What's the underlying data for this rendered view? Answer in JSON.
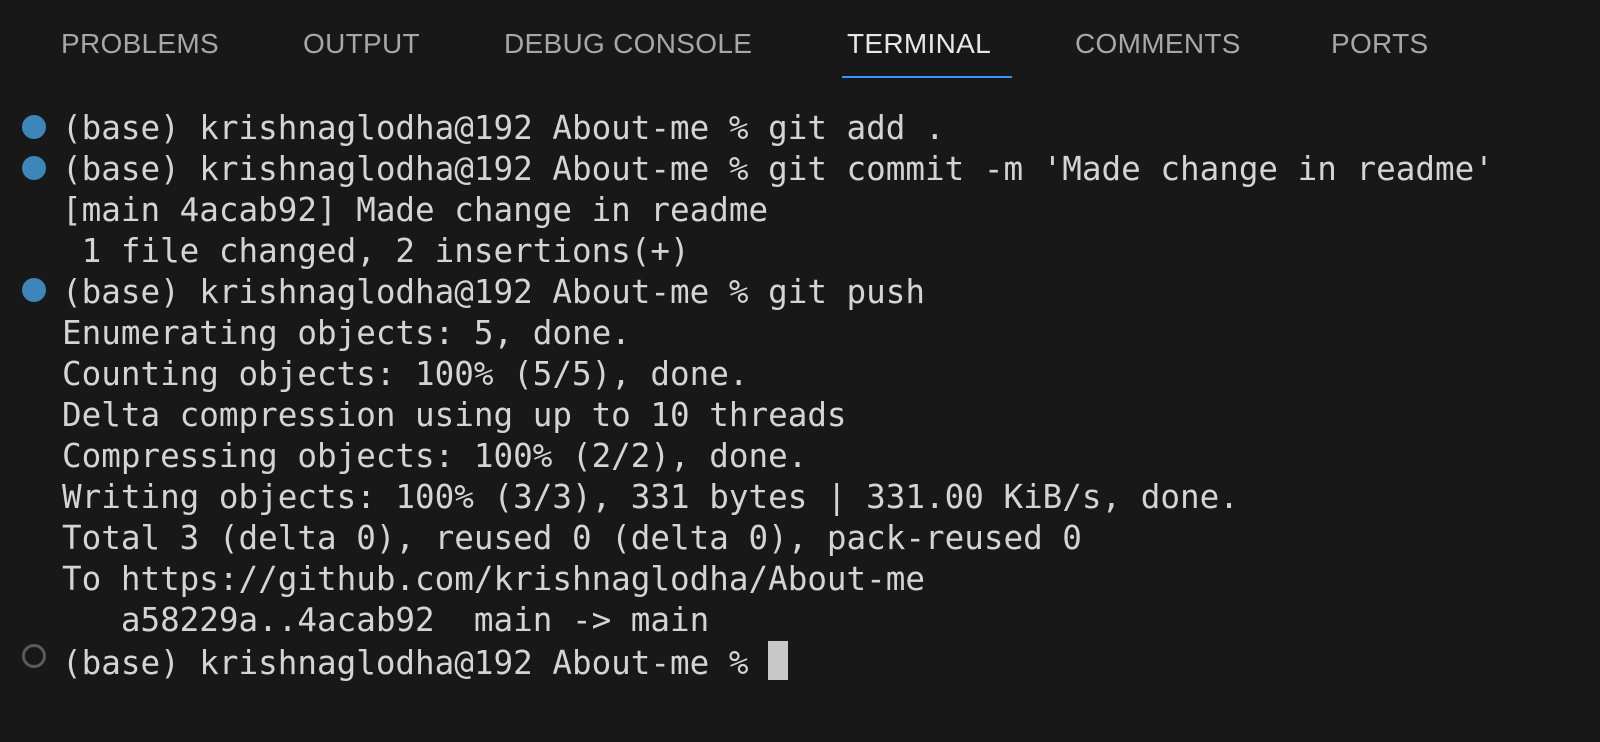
{
  "tabs": [
    {
      "label": "PROBLEMS"
    },
    {
      "label": "OUTPUT"
    },
    {
      "label": "DEBUG CONSOLE"
    },
    {
      "label": "TERMINAL",
      "active": true
    },
    {
      "label": "COMMENTS"
    },
    {
      "label": "PORTS"
    }
  ],
  "terminal": {
    "lines": [
      "(base) krishnaglodha@192 About-me % git add .",
      "(base) krishnaglodha@192 About-me % git commit -m 'Made change in readme'",
      "[main 4acab92] Made change in readme",
      " 1 file changed, 2 insertions(+)",
      "(base) krishnaglodha@192 About-me % git push",
      "Enumerating objects: 5, done.",
      "Counting objects: 100% (5/5), done.",
      "Delta compression using up to 10 threads",
      "Compressing objects: 100% (2/2), done.",
      "Writing objects: 100% (3/3), 331 bytes | 331.00 KiB/s, done.",
      "Total 3 (delta 0), reused 0 (delta 0), pack-reused 0",
      "To https://github.com/krishnaglodha/About-me",
      "   a58229a..4acab92  main -> main",
      "(base) krishnaglodha@192 About-me % "
    ]
  },
  "colors": {
    "background": "#181818",
    "active_tab_underline": "#3794ff",
    "success_decoration": "#3d86ba",
    "pending_decoration": "#5a5a5a"
  }
}
